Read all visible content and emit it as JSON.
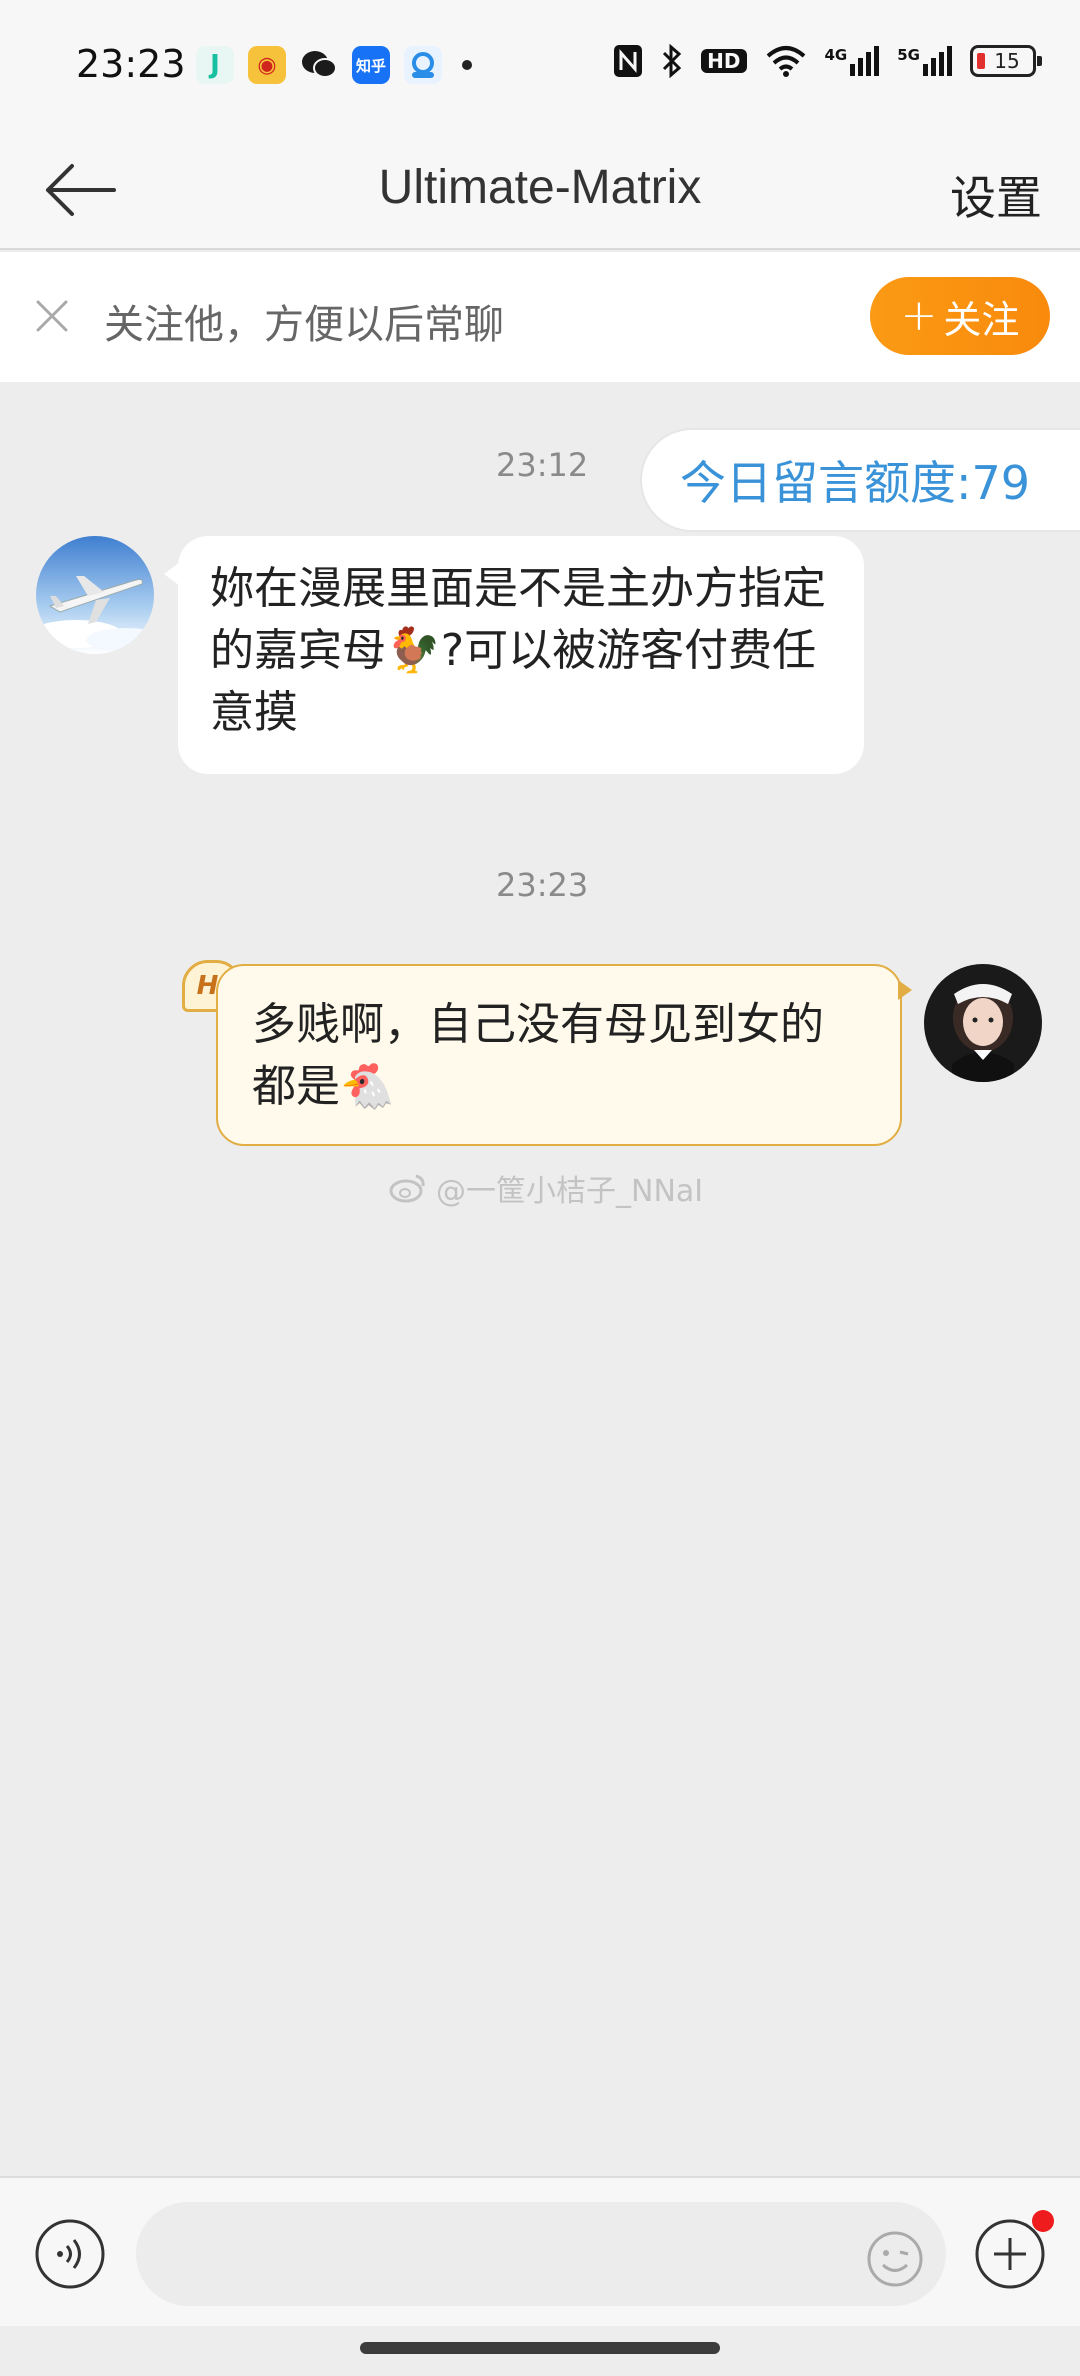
{
  "status_bar": {
    "time": "23:23",
    "apps": [
      {
        "icon": "dianping-icon",
        "glyph": "J",
        "color": "#16c0a0"
      },
      {
        "icon": "weibo-icon",
        "glyph": "微",
        "color": "#f5b935"
      },
      {
        "icon": "wechat-icon",
        "glyph": "✉",
        "color": "#1b1b1b"
      },
      {
        "icon": "zhihu-icon",
        "glyph": "知乎",
        "color": "#1772f6"
      },
      {
        "icon": "security-icon",
        "glyph": "盾",
        "color": "#2a8de8"
      }
    ],
    "indicators": [
      "nfc-icon",
      "bluetooth-icon",
      "hd-icon",
      "wifi-icon",
      "4g-signal-icon",
      "5g-signal-icon"
    ],
    "hd_label": "HD",
    "g4_label": "4G",
    "g5_label": "5G",
    "battery": "15"
  },
  "nav": {
    "title": "Ultimate-Matrix",
    "settings": "设置"
  },
  "follow_banner": {
    "text": "关注他，方便以后常聊",
    "button_plus": "+",
    "button": "关注"
  },
  "chat": {
    "time1": "23:12",
    "quota": "今日留言额度:79",
    "incoming_text": "妳在漫展里面是不是主办方指定的嘉宾母🐓?可以被游客付费任意摸",
    "time2": "23:23",
    "hi_badge": "Hi",
    "outgoing_text": "多贱啊，自己没有母见到女的都是🐔",
    "watermark": "@一筐小桔子_NNaI"
  },
  "input": {
    "placeholder": ""
  }
}
